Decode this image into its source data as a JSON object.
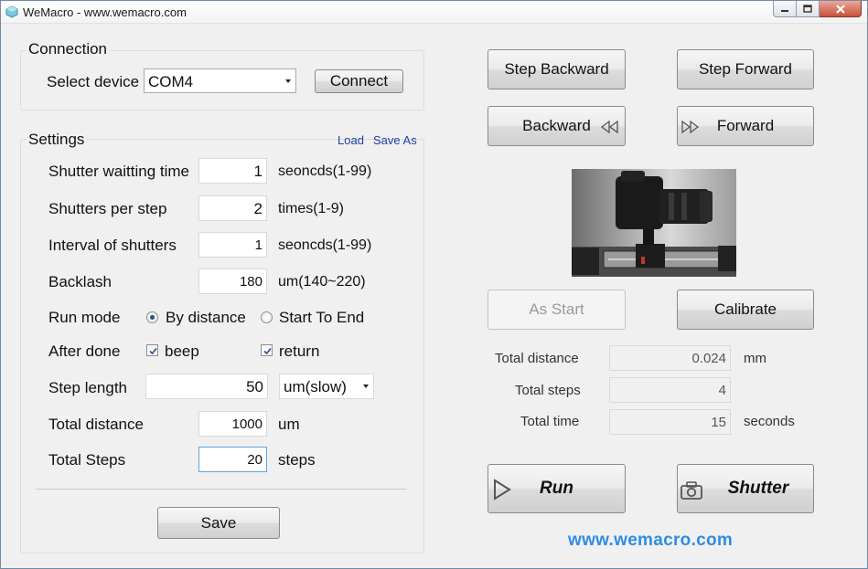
{
  "window": {
    "title": "WeMacro - www.wemacro.com"
  },
  "connection": {
    "title": "Connection",
    "select_device_label": "Select device",
    "device_value": "COM4",
    "connect_label": "Connect"
  },
  "settings": {
    "title": "Settings",
    "load_label": "Load",
    "save_as_label": "Save As",
    "shutter_wait": {
      "label": "Shutter waitting time",
      "value": "1",
      "unit": "seoncds(1-99)"
    },
    "shutters_per_step": {
      "label": "Shutters per step",
      "value": "2",
      "unit": "times(1-9)"
    },
    "interval": {
      "label": "Interval of shutters",
      "value": "1",
      "unit": "seoncds(1-99)"
    },
    "backlash": {
      "label": "Backlash",
      "value": "180",
      "unit": "um(140~220)"
    },
    "run_mode": {
      "label": "Run mode",
      "option1": "By distance",
      "option2": "Start To End",
      "selected": "By distance"
    },
    "after_done": {
      "label": "After done",
      "beep": "beep",
      "return": "return",
      "beep_checked": true,
      "return_checked": true
    },
    "step_length": {
      "label": "Step length",
      "value": "50",
      "unit_select": "um(slow)"
    },
    "total_distance": {
      "label": "Total distance",
      "value": "1000",
      "unit": "um"
    },
    "total_steps": {
      "label": "Total Steps",
      "value": "20",
      "unit": "steps"
    },
    "save_label": "Save"
  },
  "controls": {
    "step_backward": "Step Backward",
    "step_forward": "Step Forward",
    "backward": "Backward",
    "forward": "Forward",
    "as_start": "As Start",
    "calibrate": "Calibrate"
  },
  "stats": {
    "total_distance": {
      "label": "Total distance",
      "value": "0.024",
      "unit": "mm"
    },
    "total_steps": {
      "label": "Total steps",
      "value": "4"
    },
    "total_time": {
      "label": "Total time",
      "value": "15",
      "unit": "seconds"
    }
  },
  "actions": {
    "run": "Run",
    "shutter": "Shutter"
  },
  "footer": {
    "url": "www.wemacro.com"
  },
  "icons": {
    "app": "app-icon",
    "backward": "rewind-icon",
    "forward": "fast-forward-icon",
    "run": "play-icon",
    "shutter": "camera-icon"
  },
  "colors": {
    "link": "#1f3fa8",
    "url": "#2f8de4",
    "close_button": "#c9503b"
  }
}
